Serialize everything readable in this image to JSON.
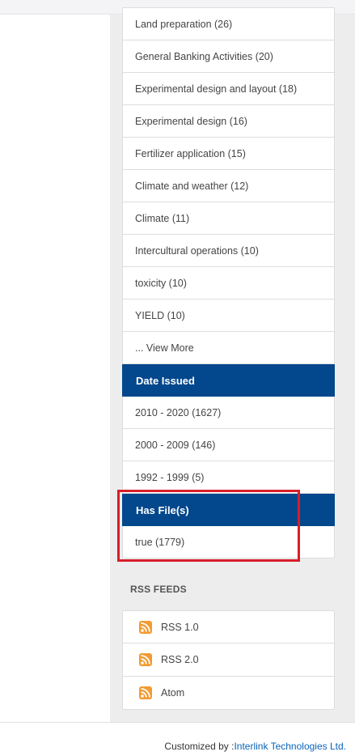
{
  "subjects": [
    "Land preparation (26)",
    "General Banking Activities (20)",
    "Experimental design and layout (18)",
    "Experimental design (16)",
    "Fertilizer application (15)",
    "Climate and weather (12)",
    "Climate (11)",
    "Intercultural operations (10)",
    "toxicity (10)",
    "YIELD (10)"
  ],
  "view_more": "... View More",
  "date_issued": {
    "header": "Date Issued",
    "items": [
      "2010 - 2020 (1627)",
      "2000 - 2009 (146)",
      "1992 - 1999 (5)"
    ]
  },
  "has_files": {
    "header": "Has File(s)",
    "items": [
      "true (1779)"
    ]
  },
  "rss": {
    "title": "RSS FEEDS",
    "items": [
      "RSS 1.0",
      "RSS 2.0",
      "Atom"
    ]
  },
  "footer": {
    "prefix": "Customized by :",
    "link": "Interlink Technologies Ltd."
  },
  "colors": {
    "header_bg": "#03478c",
    "highlight": "#d81e2a",
    "rss_icon": "#f39a31",
    "link": "#0a63b8"
  }
}
